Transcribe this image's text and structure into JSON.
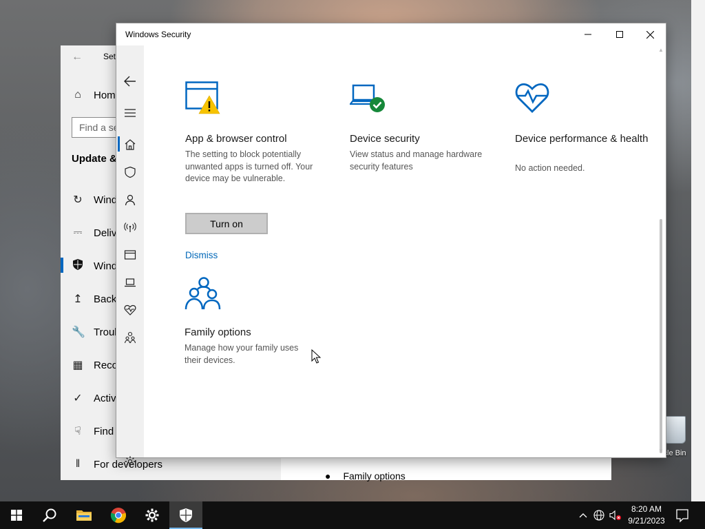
{
  "desktop": {
    "recycle_bin_label": "ycle Bin"
  },
  "settings_window": {
    "title": "Set",
    "search_placeholder": "Find a se",
    "section_title": "Update &",
    "nav_items": [
      {
        "label": "Home",
        "icon": "home-icon"
      },
      {
        "label": "Wind",
        "icon": "refresh-icon"
      },
      {
        "label": "Delive",
        "icon": "delivery-icon"
      },
      {
        "label": "Wind",
        "icon": "shield-icon"
      },
      {
        "label": "Backu",
        "icon": "backup-icon"
      },
      {
        "label": "Troub",
        "icon": "wrench-icon"
      },
      {
        "label": "Reco",
        "icon": "recovery-icon"
      },
      {
        "label": "Activ",
        "icon": "check-circle-icon"
      },
      {
        "label": "Find",
        "icon": "find-device-icon"
      },
      {
        "label": "For developers",
        "icon": "developers-icon"
      }
    ],
    "family_options_label": "Family options"
  },
  "windows_security": {
    "title": "Windows Security",
    "controls": {
      "minimize": "minimize-icon",
      "maximize": "maximize-icon",
      "close": "close-icon"
    },
    "cards": {
      "app_browser": {
        "title": "App & browser control",
        "description": "The setting to block potentially unwanted apps is turned off. Your device may be vulnerable.",
        "button_label": "Turn on",
        "link_label": "Dismiss"
      },
      "device_security": {
        "title": "Device security",
        "description": "View status and manage hardware security features"
      },
      "device_performance": {
        "title": "Device performance & health",
        "description": "No action needed."
      },
      "family_options": {
        "title": "Family options",
        "description": "Manage how your family uses their devices."
      }
    },
    "colors": {
      "accent": "#0067c0",
      "warning": "#f7c300",
      "ok": "#16883a"
    }
  },
  "taskbar": {
    "time": "8:20 AM",
    "date": "9/21/2023",
    "pinned": [
      "start-icon",
      "search-icon",
      "file-explorer-icon",
      "chrome-icon",
      "settings-icon",
      "windows-security-icon"
    ]
  }
}
